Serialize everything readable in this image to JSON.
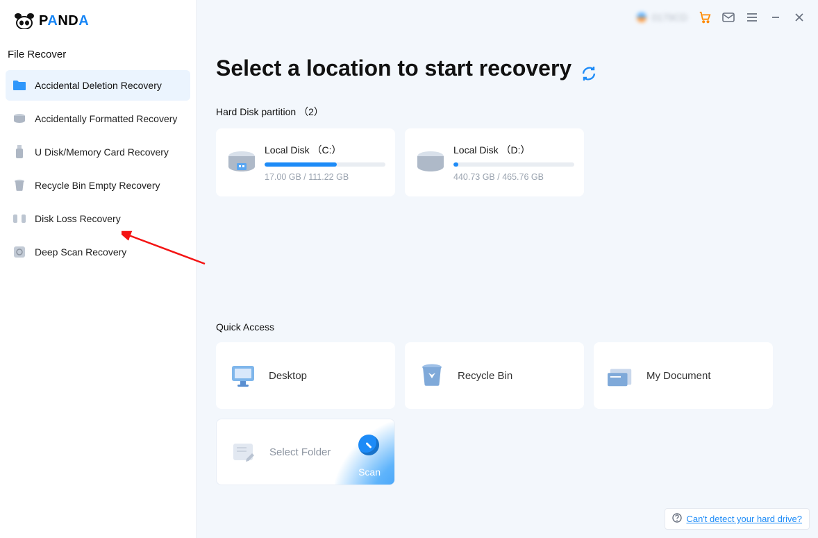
{
  "logo": {
    "name": "PANDA"
  },
  "sidebar": {
    "title": "File Recover",
    "items": [
      {
        "label": "Accidental Deletion Recovery",
        "icon": "folder-icon",
        "active": true
      },
      {
        "label": "Accidentally Formatted Recovery",
        "icon": "drive-gray-icon"
      },
      {
        "label": "U Disk/Memory Card Recovery",
        "icon": "usb-icon"
      },
      {
        "label": "Recycle Bin Empty Recovery",
        "icon": "trash-icon"
      },
      {
        "label": "Disk Loss Recovery",
        "icon": "partition-icon"
      },
      {
        "label": "Deep Scan Recovery",
        "icon": "deepscan-icon"
      }
    ]
  },
  "header": {
    "user_id": "0179CD"
  },
  "page": {
    "title": "Select a location to start recovery",
    "partition_label": "Hard Disk partition （2）",
    "quick_label": "Quick Access"
  },
  "partitions": [
    {
      "name": "Local Disk （C:）",
      "used": "17.00 GB",
      "total": "111.22 GB",
      "percent": 60
    },
    {
      "name": "Local Disk （D:）",
      "used": "440.73 GB",
      "total": "465.76 GB",
      "percent": 4
    }
  ],
  "quick": [
    {
      "label": "Desktop",
      "icon": "desktop"
    },
    {
      "label": "Recycle Bin",
      "icon": "bin"
    },
    {
      "label": "My Document",
      "icon": "doc"
    }
  ],
  "select_folder": {
    "label": "Select Folder",
    "scan": "Scan"
  },
  "help": {
    "text": "Can't detect your hard drive?"
  }
}
